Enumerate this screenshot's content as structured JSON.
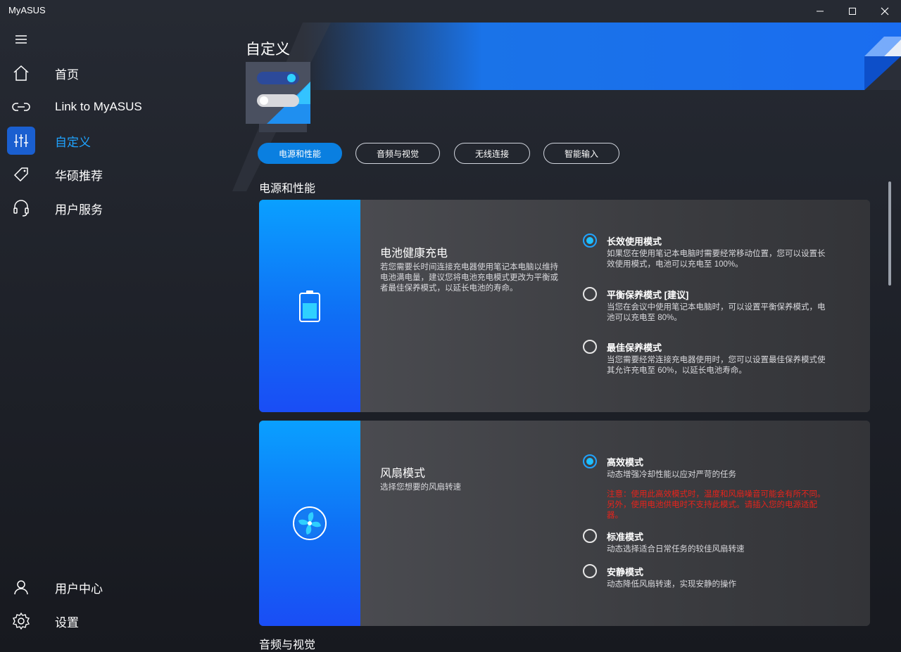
{
  "window": {
    "title": "MyASUS"
  },
  "sidebar": {
    "items": [
      {
        "label": "首页",
        "icon": "home-icon"
      },
      {
        "label": "Link to MyASUS",
        "icon": "link-icon"
      },
      {
        "label": "自定义",
        "icon": "sliders-icon",
        "active": true
      },
      {
        "label": "华硕推荐",
        "icon": "tag-icon"
      },
      {
        "label": "用户服务",
        "icon": "headset-icon"
      }
    ],
    "bottom": [
      {
        "label": "用户中心",
        "icon": "user-icon"
      },
      {
        "label": "设置",
        "icon": "gear-icon"
      }
    ]
  },
  "main": {
    "title": "自定义",
    "tabs": [
      {
        "label": "电源和性能",
        "active": true
      },
      {
        "label": "音频与视觉"
      },
      {
        "label": "无线连接"
      },
      {
        "label": "智能输入"
      }
    ],
    "sections": [
      {
        "title": "电源和性能"
      },
      {
        "title": "音频与视觉"
      }
    ],
    "battery_card": {
      "icon": "battery-icon",
      "title": "电池健康充电",
      "description": "若您需要长时间连接充电器使用笔记本电脑以维持电池满电量，建议您将电池充电模式更改为平衡或者最佳保养模式，以延长电池的寿命。",
      "options": [
        {
          "label": "长效使用模式",
          "desc": "如果您在使用笔记本电脑时需要经常移动位置，您可以设置长效使用模式，电池可以充电至 100%。",
          "checked": true
        },
        {
          "label": "平衡保养模式 [建议]",
          "desc": "当您在会议中使用笔记本电脑时，可以设置平衡保养模式，电池可以充电至 80%。",
          "checked": false
        },
        {
          "label": "最佳保养模式",
          "desc": "当您需要经常连接充电器使用时，您可以设置最佳保养模式使其允许充电至 60%，以延长电池寿命。",
          "checked": false
        }
      ]
    },
    "fan_card": {
      "icon": "fan-icon",
      "title": "风扇模式",
      "description": "选择您想要的风扇转速",
      "options": [
        {
          "label": "高效模式",
          "desc": "动态增强冷却性能以应对严苛的任务",
          "warning": "注意：使用此高效模式时，温度和风扇噪音可能会有所不同。另外，使用电池供电时不支持此模式。请插入您的电源适配器。",
          "checked": true
        },
        {
          "label": "标准模式",
          "desc": "动态选择适合日常任务的较佳风扇转速",
          "checked": false
        },
        {
          "label": "安静模式",
          "desc": "动态降低风扇转速，实现安静的操作",
          "checked": false
        }
      ]
    }
  },
  "colors": {
    "accent": "#1fa3ff",
    "active_nav": "#1a5fd0",
    "tab_active": "#0a7fe0",
    "warning": "#e8231b"
  }
}
